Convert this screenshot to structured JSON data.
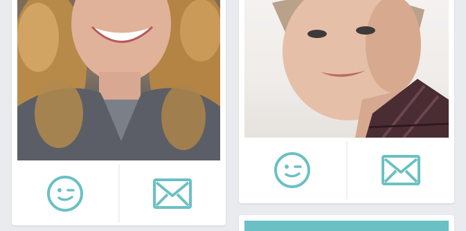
{
  "colors": {
    "background": "#e9ebef",
    "card": "#ffffff",
    "icon_accent": "#6bc0c4",
    "bar_accent": "#6bc0c4"
  },
  "cards": [
    {
      "photo": "profile-photo-curly-hair-woman",
      "actions": [
        {
          "icon": "smiley-wink-icon"
        },
        {
          "icon": "envelope-icon"
        }
      ]
    },
    {
      "photo": "profile-photo-short-hair-woman",
      "actions": [
        {
          "icon": "smiley-wink-icon"
        },
        {
          "icon": "envelope-icon"
        }
      ]
    }
  ]
}
